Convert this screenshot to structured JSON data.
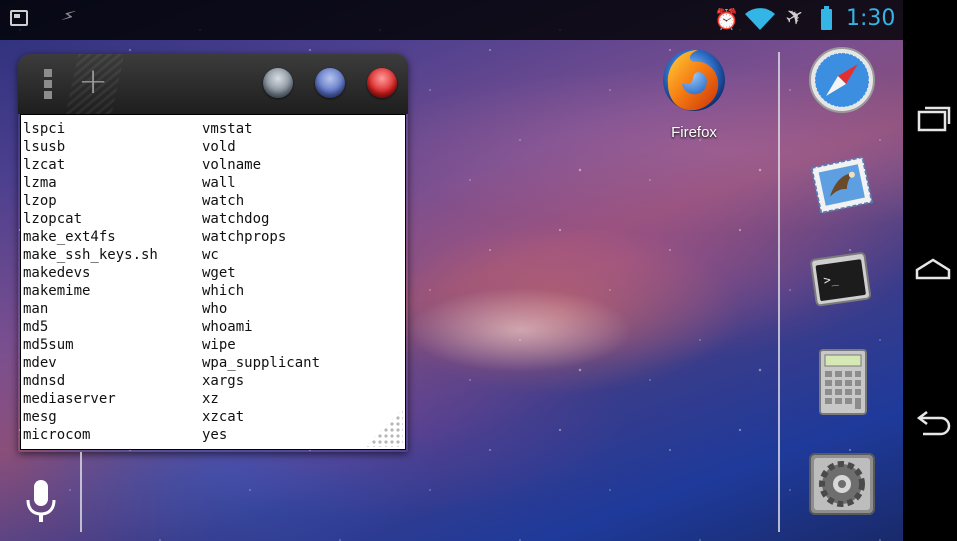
{
  "status_bar": {
    "time": "1:30",
    "left_icons": [
      "terminal-icon",
      "usb-debug-icon"
    ],
    "right_icons": [
      "alarm-icon",
      "wifi-icon",
      "airplane-icon",
      "battery-icon"
    ],
    "accent_color": "#33b5e5"
  },
  "terminal_widget": {
    "buttons": [
      "menu-icon",
      "add-icon",
      "gray-button",
      "blue-button",
      "red-button"
    ],
    "left_column": [
      "lspci",
      "lsusb",
      "lzcat",
      "lzma",
      "lzop",
      "lzopcat",
      "make_ext4fs",
      "make_ssh_keys.sh",
      "makedevs",
      "makemime",
      "man",
      "md5",
      "md5sum",
      "mdev",
      "mdnsd",
      "mediaserver",
      "mesg",
      "microcom"
    ],
    "right_column": [
      "vmstat",
      "vold",
      "volname",
      "wall",
      "watch",
      "watchdog",
      "watchprops",
      "wc",
      "wget",
      "which",
      "who",
      "whoami",
      "wipe",
      "wpa_supplicant",
      "xargs",
      "xz",
      "xzcat",
      "yes"
    ]
  },
  "desktop": {
    "firefox_label": "Firefox"
  },
  "dock": {
    "apps": [
      "safari-icon",
      "mail-icon",
      "terminal-app-icon",
      "calculator-icon",
      "system-preferences-icon"
    ]
  },
  "nav_bar": {
    "buttons": [
      "recent-apps",
      "home",
      "back"
    ]
  }
}
